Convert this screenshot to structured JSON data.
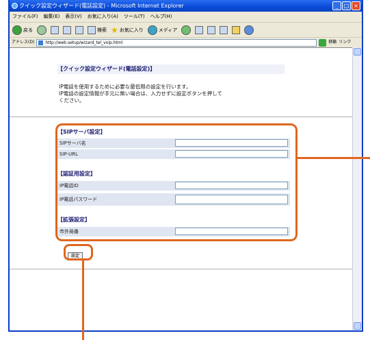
{
  "window": {
    "title": "クイック設定ウィザード(電話設定) - Microsoft Internet Explorer",
    "controls": [
      "_",
      "□",
      "×"
    ]
  },
  "menubar": {
    "items": [
      "ファイル(F)",
      "編集(E)",
      "表示(V)",
      "お気に入り(A)",
      "ツール(T)",
      "ヘルプ(H)"
    ]
  },
  "toolbar": {
    "back_label": "戻る",
    "search_label": "検索",
    "favorites_label": "お気に入り",
    "media_label": "メディア"
  },
  "addressbar": {
    "label": "アドレス(D)",
    "url": "http://web.setup/wizard_tel_voip.html",
    "go_label": "移動",
    "links_label": "リンク"
  },
  "page": {
    "title": "【クイック設定ウィザード(電話設定)】",
    "description_lines": [
      "IP電話を使用するために必要な最低限の設定を行います。",
      "IP電話の設定情報が手元に無い場合は、入力せずに設定ボタンを押して",
      "ください。"
    ]
  },
  "form": {
    "sip_section": {
      "heading": "【SIPサーバ設定】",
      "fields": [
        {
          "label": "SIPサーバ名",
          "value": ""
        },
        {
          "label": "SIP-URL",
          "value": ""
        }
      ]
    },
    "auth_section": {
      "heading": "【認証用設定】",
      "fields": [
        {
          "label": "IP電話ID",
          "value": ""
        },
        {
          "label": "IP電話パスワード",
          "value": ""
        }
      ]
    },
    "ext_section": {
      "heading": "【拡張設定】",
      "fields": [
        {
          "label": "市外局番",
          "value": ""
        }
      ]
    },
    "submit_label": "設定"
  },
  "colors": {
    "callout": "#e0661e",
    "titlebar": "#0a4bd8",
    "heading": "#1a1a6e",
    "row_bg": "#dfe6f1"
  }
}
